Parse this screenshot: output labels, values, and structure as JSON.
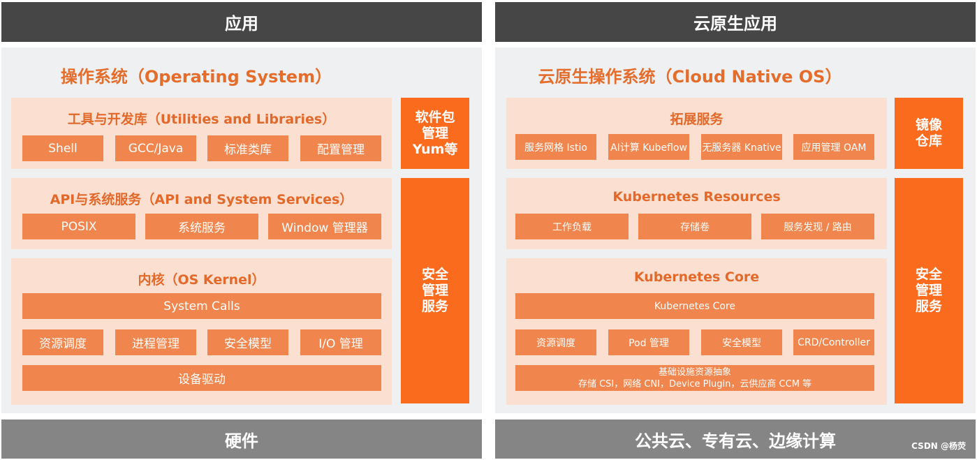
{
  "left": {
    "top_bar": "应用",
    "os_title": "操作系统（Operating System）",
    "layers": [
      {
        "title": "工具与开发库（Utilities and Libraries）",
        "boxes": [
          "Shell",
          "GCC/Java",
          "标准类库",
          "配置管理"
        ]
      },
      {
        "title": "API与系统服务（API and System Services）",
        "boxes": [
          "POSIX",
          "系统服务",
          "Window 管理器"
        ]
      },
      {
        "title": "内核（OS Kernel）",
        "full_box": "System Calls",
        "boxes": [
          "资源调度",
          "进程管理",
          "安全模型",
          "I/O 管理"
        ],
        "bottom_box": "设备驱动"
      }
    ],
    "side_top": [
      "软件包",
      "管理",
      "Yum等"
    ],
    "side_bottom": [
      "安全",
      "管理",
      "服务"
    ],
    "bottom_bar": "硬件"
  },
  "right": {
    "top_bar": "云原生应用",
    "os_title": "云原生操作系统（Cloud Native OS）",
    "layers": [
      {
        "title": "拓展服务",
        "boxes": [
          "服务网格 Istio",
          "AI计算 Kubeflow",
          "无服务器 Knative",
          "应用管理 OAM"
        ]
      },
      {
        "title": "Kubernetes Resources",
        "boxes": [
          "工作负载",
          "存储卷",
          "服务发现 / 路由"
        ]
      },
      {
        "title": "Kubernetes Core",
        "full_box": "Kubernetes Core",
        "boxes": [
          "资源调度",
          "Pod 管理",
          "安全模型",
          "CRD/Controller"
        ],
        "bottom_box_lines": [
          "基础设施资源抽象",
          "存储 CSI，网络 CNI，Device Plugin，云供应商 CCM 等"
        ]
      }
    ],
    "side_top": [
      "镜像",
      "仓库"
    ],
    "side_bottom": [
      "安全",
      "管理",
      "服务"
    ],
    "bottom_bar": "公共云、专有云、边缘计算"
  },
  "watermark": "CSDN @杨荧",
  "colors": {
    "dark_bar": "#464646",
    "gray_bar": "#858585",
    "background": "#eff0f2",
    "layer_bg": "#fbdfd0",
    "box": "#f0864e",
    "accent": "#fa6b1d",
    "title_text": "#e56d2c"
  }
}
